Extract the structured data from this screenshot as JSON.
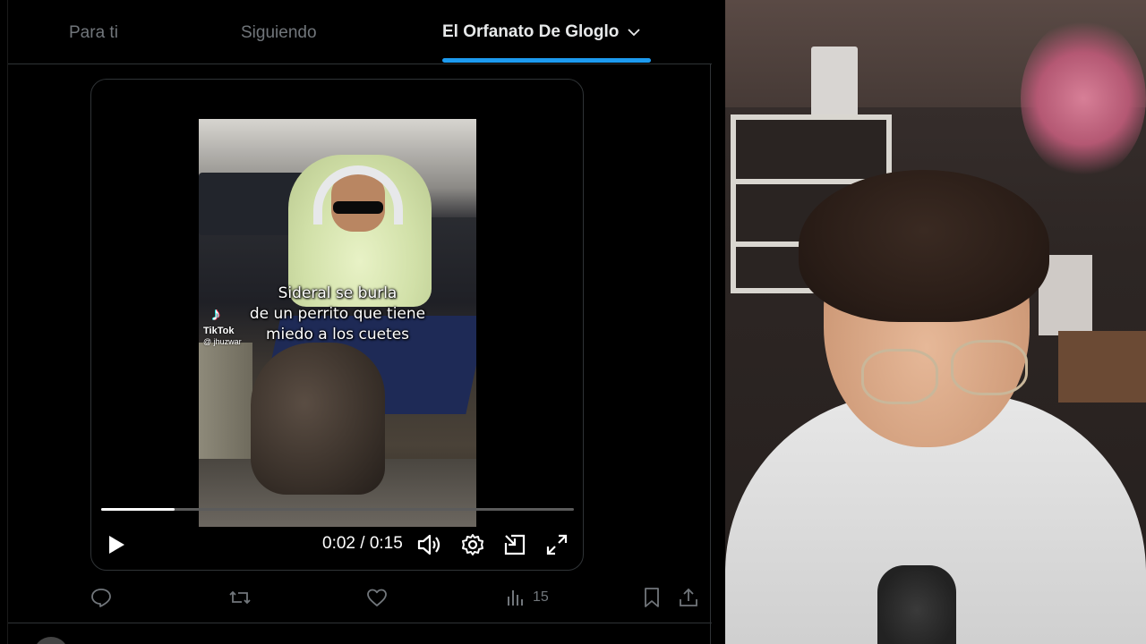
{
  "tabs": {
    "for_you": "Para ti",
    "following": "Siguiendo",
    "list": "El Orfanato De Gloglo"
  },
  "video": {
    "caption_lines": [
      "Sideral se burla",
      "de un perrito que tiene",
      "miedo a los cuetes"
    ],
    "watermark_brand": "TikTok",
    "watermark_handle": "@ jhuzwar",
    "time": "0:02 / 0:15",
    "progress": 0.155
  },
  "actions": {
    "views": "15"
  },
  "colors": {
    "accent": "#1d9bf0",
    "muted": "#71767b",
    "text": "#e7e9ea"
  },
  "icons": {
    "tab_dropdown": "chevron-down-icon",
    "play": "play-icon",
    "volume": "volume-icon",
    "settings": "gear-icon",
    "dock": "dock-icon",
    "fullscreen": "fullscreen-icon",
    "reply": "reply-icon",
    "retweet": "retweet-icon",
    "like": "heart-icon",
    "views": "bar-chart-icon",
    "bookmark": "bookmark-icon",
    "share": "share-icon"
  }
}
